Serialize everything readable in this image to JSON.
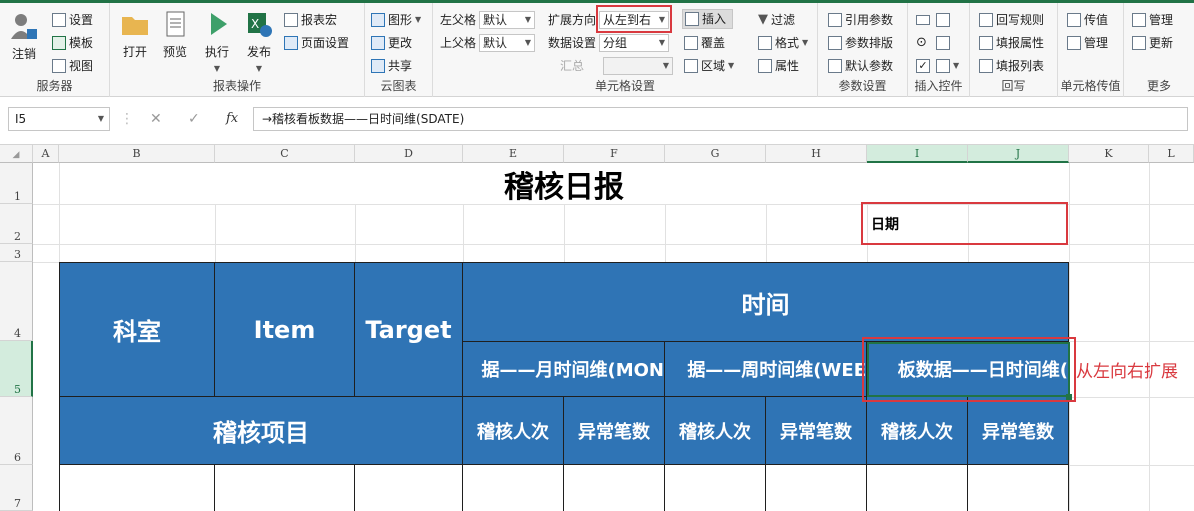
{
  "ribbon": {
    "server": {
      "label": "服务器",
      "logout": "注销",
      "settings": "设置",
      "template": "模板",
      "view": "视图"
    },
    "report_ops": {
      "label": "报表操作",
      "open": "打开",
      "preview": "预览",
      "execute": "执行",
      "publish": "发布",
      "report_macro": "报表宏",
      "page_setup": "页面设置"
    },
    "cloud": {
      "label": "云图表",
      "chart": "图形",
      "change": "更改",
      "share": "共享"
    },
    "cell_settings": {
      "label": "单元格设置",
      "left_parent_label": "左父格",
      "left_parent_value": "默认",
      "up_parent_label": "上父格",
      "up_parent_value": "默认",
      "expand_dir_label": "扩展方向",
      "expand_dir_value": "从左到右",
      "data_setting_label": "数据设置",
      "data_setting_value": "分组",
      "summary_label": "汇总",
      "insert": "插入",
      "cover": "覆盖",
      "area": "区域",
      "filter": "过滤",
      "format": "格式",
      "attribute": "属性"
    },
    "params": {
      "label": "参数设置",
      "ref_param": "引用参数",
      "param_layout": "参数排版",
      "default_param": "默认参数"
    },
    "controls": {
      "label": "插入控件"
    },
    "writeback": {
      "label": "回写",
      "rule": "回写规则",
      "fill_attr": "填报属性",
      "fill_list": "填报列表"
    },
    "cell_pass": {
      "label": "单元格传值",
      "pass": "传值",
      "manage": "管理"
    },
    "more": {
      "label": "更多",
      "manage": "管理",
      "update": "更新"
    }
  },
  "formula_bar": {
    "name_box": "I5",
    "cancel": "✕",
    "confirm": "✓",
    "fx": "fx",
    "formula": "→稽核看板数据——日时间维(SDATE)"
  },
  "columns": [
    "A",
    "B",
    "C",
    "D",
    "E",
    "F",
    "G",
    "H",
    "I",
    "J",
    "K",
    "L"
  ],
  "rows": [
    "1",
    "2",
    "3",
    "4",
    "5",
    "6",
    "7"
  ],
  "sheet": {
    "title": "稽核日报",
    "date_label": "日期",
    "dept": "科室",
    "item": "Item",
    "target": "Target",
    "time": "时间",
    "month_dim": "据——月时间维(MON",
    "week_dim": "据——周时间维(WEE",
    "day_dim": "板数据——日时间维(",
    "audit_item": "稽核项目",
    "audit_count_1": "稽核人次",
    "abnormal_1": "异常笔数",
    "audit_count_2": "稽核人次",
    "abnormal_2": "异常笔数",
    "audit_count_3": "稽核人次",
    "abnormal_3": "异常笔数",
    "annotation": "从左向右扩展"
  },
  "colors": {
    "header_blue": "#2f74b5",
    "highlight_red": "#d9393f",
    "excel_green": "#217346"
  }
}
